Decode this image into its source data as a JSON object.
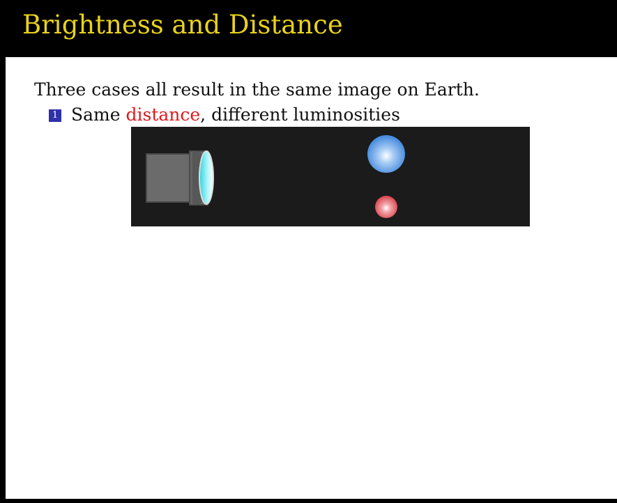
{
  "slide": {
    "title": "Brightness and Distance",
    "intro": "Three cases all result in the same image on Earth.",
    "bullet": {
      "number": "1",
      "prefix": "Same ",
      "highlight": "distance",
      "suffix": ", different luminosities"
    }
  },
  "colors": {
    "title": "#e8d21c",
    "highlight": "#e0181b",
    "bullet_box": "#2e31a8",
    "diagram_bg": "#1b1b1b"
  },
  "icons": [
    "telescope-icon",
    "blue-star-icon",
    "red-star-icon"
  ]
}
